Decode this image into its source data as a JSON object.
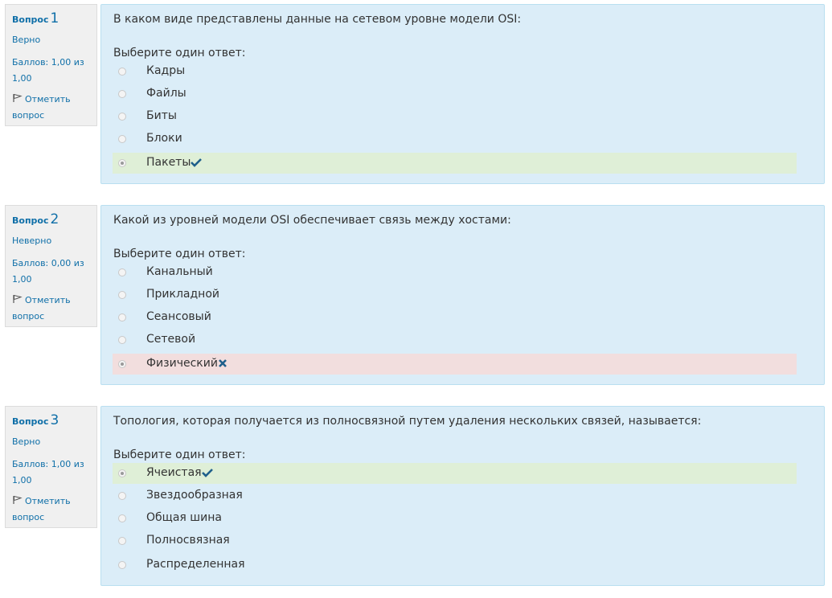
{
  "questions": [
    {
      "label": "Вопрос",
      "number": "1",
      "state": "Верно",
      "grade_line1": "Баллов: 1,00 из",
      "grade_line2": "1,00",
      "flag_line1": "Отметить",
      "flag_line2": "вопрос",
      "text": "В каком виде представлены данные на сетевом уровне модели OSI:",
      "prompt": "Выберите один ответ:",
      "answers": [
        {
          "label": "Кадры"
        },
        {
          "label": "Файлы"
        },
        {
          "label": "Биты"
        },
        {
          "label": "Блоки"
        },
        {
          "label": "Пакеты",
          "selected": true,
          "result": "correct",
          "icon": "check-icon"
        }
      ]
    },
    {
      "label": "Вопрос",
      "number": "2",
      "state": "Неверно",
      "grade_line1": "Баллов: 0,00 из",
      "grade_line2": "1,00",
      "flag_line1": "Отметить",
      "flag_line2": "вопрос",
      "text": "Какой из уровней модели OSI обеспечивает связь между хостами:",
      "prompt": "Выберите один ответ:",
      "answers": [
        {
          "label": "Канальный"
        },
        {
          "label": "Прикладной"
        },
        {
          "label": "Сеансовый"
        },
        {
          "label": "Сетевой"
        },
        {
          "label": "Физический",
          "selected": true,
          "result": "incorrect",
          "icon": "cross-icon"
        }
      ]
    },
    {
      "label": "Вопрос",
      "number": "3",
      "state": "Верно",
      "grade_line1": "Баллов: 1,00 из",
      "grade_line2": "1,00",
      "flag_line1": "Отметить",
      "flag_line2": "вопрос",
      "text": "Топология, которая получается из полносвязной путем удаления нескольких связей, называется:",
      "prompt": "Выберите один ответ:",
      "answers": [
        {
          "label": "Ячеистая",
          "selected": true,
          "result": "correct",
          "icon": "check-icon"
        },
        {
          "label": "Звездообразная"
        },
        {
          "label": "Общая шина"
        },
        {
          "label": "Полносвязная"
        },
        {
          "label": "Распределенная"
        }
      ]
    }
  ],
  "colors": {
    "link": "#0f6fa8",
    "content_bg": "#dbedf8",
    "correct_bg": "#dfefd7",
    "incorrect_bg": "#f2dede",
    "mark": "#1f5f8b"
  }
}
